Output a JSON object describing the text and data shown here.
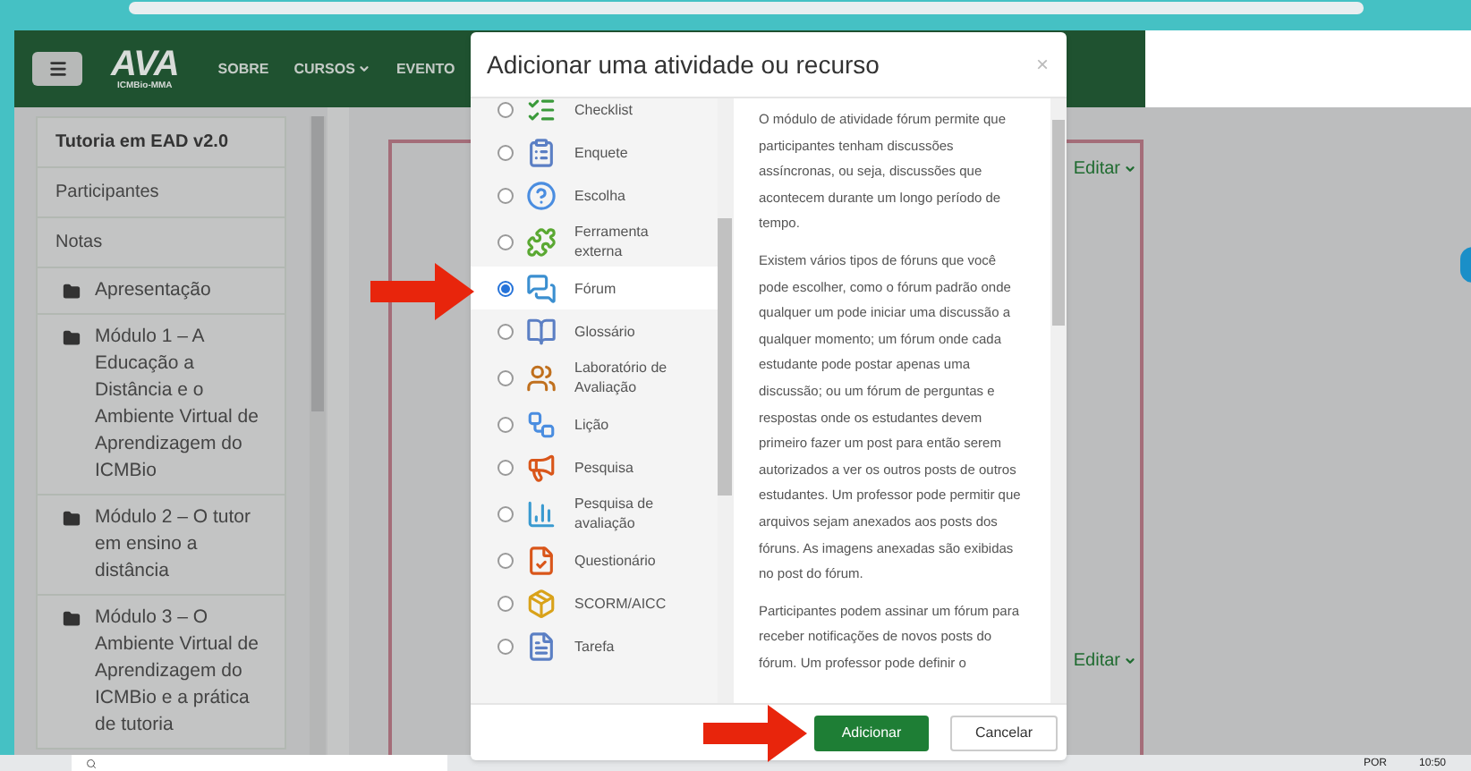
{
  "navbar": {
    "logo": "AVA",
    "logo_sub": "ICMBio-MMA",
    "links": [
      {
        "label": "SOBRE",
        "dropdown": false
      },
      {
        "label": "CURSOS",
        "dropdown": true
      },
      {
        "label": "EVENTO",
        "dropdown": false
      }
    ]
  },
  "sidebar": {
    "items": [
      {
        "label": "Tutoria em EAD v2.0",
        "kind": "title"
      },
      {
        "label": "Participantes",
        "kind": "link"
      },
      {
        "label": "Notas",
        "kind": "link"
      },
      {
        "label": "Apresentação",
        "kind": "section"
      },
      {
        "label": "Módulo 1 – A Educação a Distância e o Ambiente Virtual de Aprendizagem do ICMBio",
        "kind": "section"
      },
      {
        "label": "Módulo 2 – O tutor em ensino a distância",
        "kind": "section"
      },
      {
        "label": "Módulo 3 – O Ambiente Virtual de Aprendizagem do ICMBio e a prática de tutoria",
        "kind": "section"
      }
    ]
  },
  "content": {
    "edit_links": [
      "Editar",
      "Editar"
    ]
  },
  "modal": {
    "title": "Adicionar uma atividade ou recurso",
    "close": "×",
    "options": [
      {
        "label": "Checklist",
        "selected": false
      },
      {
        "label": "Enquete",
        "selected": false
      },
      {
        "label": "Escolha",
        "selected": false
      },
      {
        "label": "Ferramenta externa",
        "selected": false
      },
      {
        "label": "Fórum",
        "selected": true
      },
      {
        "label": "Glossário",
        "selected": false
      },
      {
        "label": "Laboratório de Avaliação",
        "selected": false
      },
      {
        "label": "Lição",
        "selected": false
      },
      {
        "label": "Pesquisa",
        "selected": false
      },
      {
        "label": "Pesquisa de avaliação",
        "selected": false
      },
      {
        "label": "Questionário",
        "selected": false
      },
      {
        "label": "SCORM/AICC",
        "selected": false
      },
      {
        "label": "Tarefa",
        "selected": false
      }
    ],
    "description": [
      "O módulo de atividade fórum permite que participantes tenham discussões assíncronas, ou seja, discussões que acontecem durante um longo período de tempo.",
      "Existem vários tipos de fóruns que você pode escolher, como o fórum padrão onde qualquer um pode iniciar uma discussão a qualquer momento; um fórum onde cada estudante pode postar apenas uma discussão; ou um fórum de perguntas e respostas onde os estudantes devem primeiro fazer um post para então serem autorizados a ver os outros posts de outros estudantes. Um professor pode permitir que arquivos sejam anexados aos posts dos fóruns. As imagens anexadas são exibidas no post do fórum.",
      "Participantes podem assinar um fórum para receber notificações de novos posts do fórum. Um professor pode definir o"
    ],
    "buttons": [
      {
        "label": "Adicionar",
        "kind": "primary"
      },
      {
        "label": "Cancelar",
        "kind": "secondary"
      }
    ]
  },
  "taskbar": {
    "language": "POR",
    "time": "10:50"
  }
}
